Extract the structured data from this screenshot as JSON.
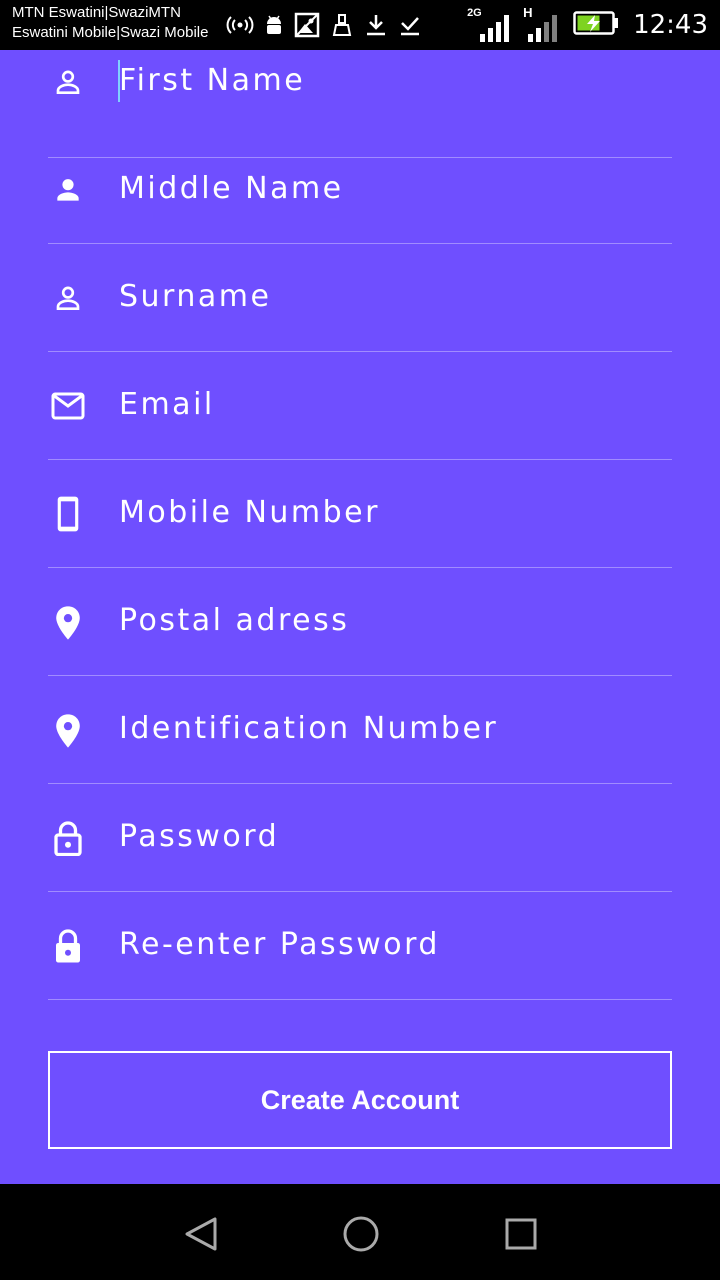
{
  "status_bar": {
    "carrier_line1": "MTN Eswatini|SwaziMTN",
    "carrier_line2": "Eswatini Mobile|Swazi Mobile",
    "network_1": "2G",
    "network_2": "H",
    "time": "12:43",
    "icons": [
      "hotspot-icon",
      "android-icon",
      "image-icon",
      "cleaner-icon",
      "download-icon",
      "check-download-icon",
      "signal-icon",
      "signal-icon",
      "battery-charging-icon"
    ]
  },
  "form": {
    "fields": [
      {
        "placeholder": "First Name",
        "icon": "person-outline-icon"
      },
      {
        "placeholder": "Middle Name",
        "icon": "person-icon"
      },
      {
        "placeholder": "Surname",
        "icon": "person-outline-icon"
      },
      {
        "placeholder": "Email",
        "icon": "mail-icon"
      },
      {
        "placeholder": "Mobile Number",
        "icon": "phone-icon"
      },
      {
        "placeholder": "Postal adress",
        "icon": "location-icon"
      },
      {
        "placeholder": "Identification Number",
        "icon": "location-icon"
      },
      {
        "placeholder": "Password",
        "icon": "lock-outline-icon"
      },
      {
        "placeholder": "Re-enter Password",
        "icon": "lock-icon"
      }
    ],
    "submit_label": "Create Account"
  },
  "nav_bar": {
    "buttons": [
      "back-icon",
      "home-icon",
      "recents-icon"
    ]
  },
  "colors": {
    "background": "#6f4fff",
    "text": "#ffffff",
    "cursor": "#7fd0ff"
  }
}
